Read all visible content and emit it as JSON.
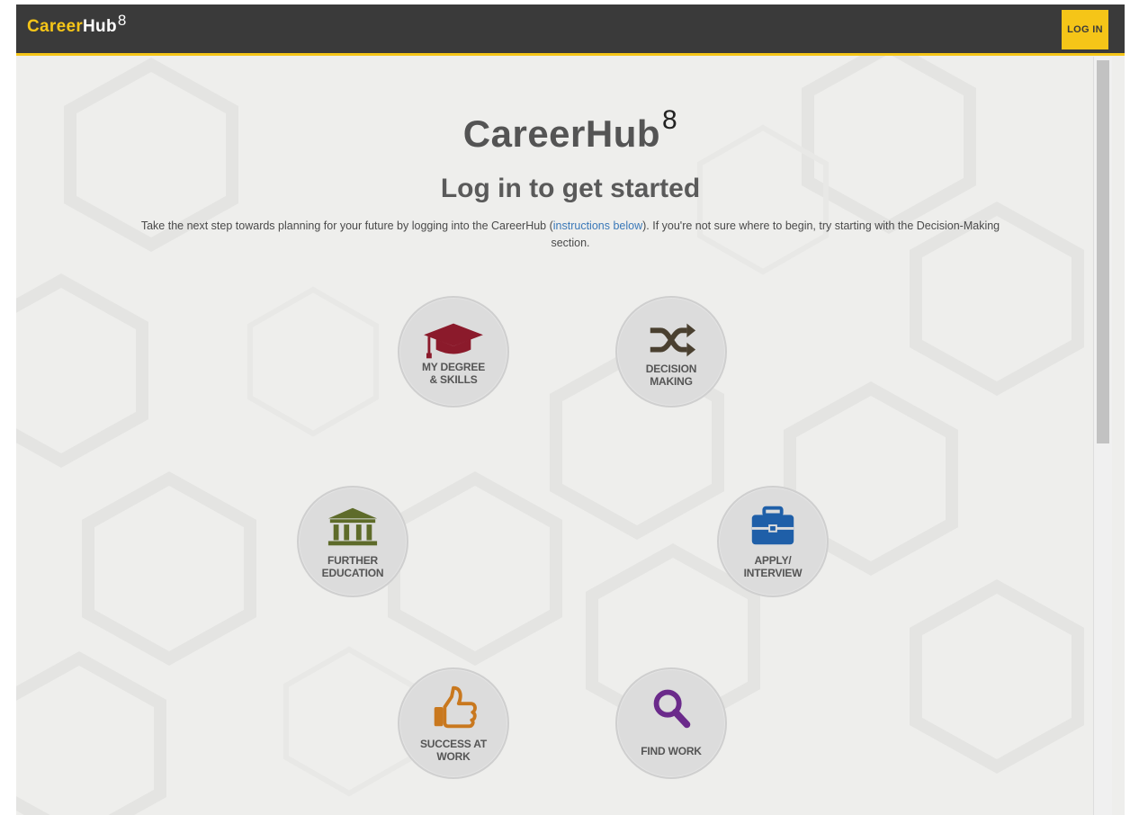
{
  "header": {
    "brand_part1": "Career",
    "brand_part2": "Hub",
    "brand_mark": "8",
    "login_label": "LOG IN"
  },
  "hero": {
    "logo_part1": "CareerHub",
    "logo_mark": "8",
    "title": "Log in to get started",
    "intro_before": "Take the next step towards planning for your future by logging into the CareerHub (",
    "intro_link": "instructions below",
    "intro_after": "). If you're not sure where to begin, try starting with the Decision-Making section."
  },
  "sections": [
    {
      "line1": "MY DEGREE",
      "line2": "& SKILLS",
      "icon": "graduation-cap-icon",
      "color": "#8b1a2b"
    },
    {
      "line1": "DECISION",
      "line2": "MAKING",
      "icon": "shuffle-icon",
      "color": "#4a4030"
    },
    {
      "line1": "FURTHER",
      "line2": "EDUCATION",
      "icon": "institution-icon",
      "color": "#5e6b2a"
    },
    {
      "line1": "APPLY/",
      "line2": "INTERVIEW",
      "icon": "briefcase-icon",
      "color": "#1f5fa8"
    },
    {
      "line1": "SUCCESS AT",
      "line2": "WORK",
      "icon": "thumbs-up-icon",
      "color": "#c9781e"
    },
    {
      "line1": "FIND WORK",
      "line2": "",
      "icon": "magnifier-icon",
      "color": "#6b2a8b"
    }
  ],
  "colors": {
    "topbar": "#3a3a3a",
    "accent": "#f5c518",
    "background": "#eeeeec",
    "link": "#3a78b8"
  }
}
